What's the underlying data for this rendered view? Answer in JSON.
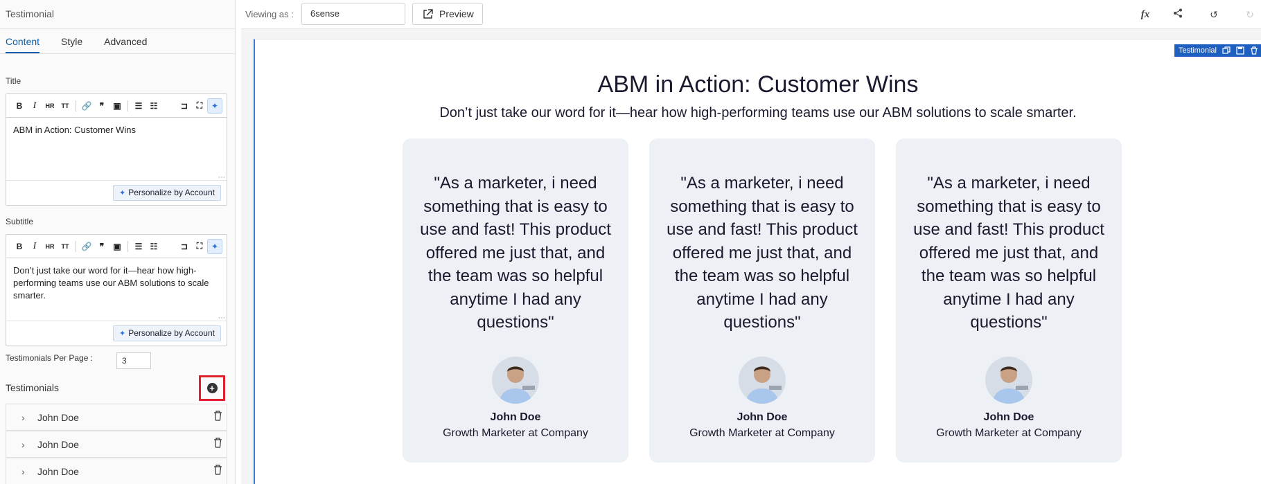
{
  "panel": {
    "title": "Testimonial",
    "tabs": [
      {
        "label": "Content",
        "active": true
      },
      {
        "label": "Style",
        "active": false
      },
      {
        "label": "Advanced",
        "active": false
      }
    ],
    "title_field": {
      "label": "Title",
      "value": "ABM in Action: Customer Wins",
      "personalize_label": "Personalize by Account"
    },
    "subtitle_field": {
      "label": "Subtitle",
      "value": "Don’t just take our word for it—hear how high-performing teams use our ABM solutions to scale smarter.",
      "personalize_label": "Personalize by Account"
    },
    "toolbar": {
      "bold": "B",
      "italic": "I",
      "hr": "HR",
      "strike": "TT"
    },
    "per_page": {
      "label": "Testimonials Per Page :",
      "value": "3"
    },
    "testimonials": {
      "label": "Testimonials",
      "items": [
        {
          "name": "John Doe"
        },
        {
          "name": "John Doe"
        },
        {
          "name": "John Doe"
        }
      ]
    }
  },
  "topbar": {
    "viewing_label": "Viewing as :",
    "viewing_value": "6sense",
    "preview_label": "Preview",
    "icons": [
      "fx-icon",
      "share-icon",
      "undo-icon",
      "redo-icon"
    ]
  },
  "canvas": {
    "widget_tag": "Testimonial",
    "title": "ABM in Action: Customer Wins",
    "subtitle": "Don’t just take our word for it—hear how high-performing teams use our ABM solutions to scale smarter.",
    "cards": [
      {
        "quote": "\"As a marketer, i need something that is easy to use and fast! This product offered me just that, and the team was so helpful anytime I had any questions\"",
        "name": "John Doe",
        "role": "Growth Marketer at Company"
      },
      {
        "quote": "\"As a marketer, i need something that is easy to use and fast! This product offered me just that, and the team was so helpful anytime I had any questions\"",
        "name": "John Doe",
        "role": "Growth Marketer at Company"
      },
      {
        "quote": "\"As a marketer, i need something that is easy to use and fast! This product offered me just that, and the team was so helpful anytime I had any questions\"",
        "name": "John Doe",
        "role": "Growth Marketer at Company"
      }
    ]
  },
  "colors": {
    "accent": "#0b5fae",
    "highlight": "#e0202c",
    "card_bg": "#edf0f4",
    "widget_tag": "#1f5fbf"
  }
}
